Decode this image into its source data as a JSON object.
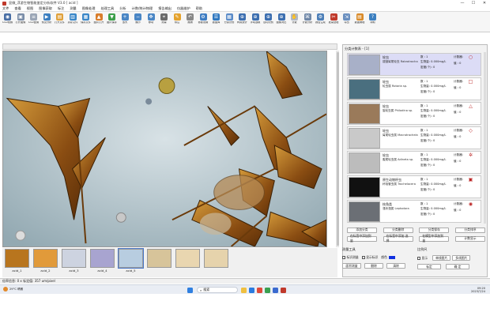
{
  "window": {
    "title": "显微_浮游生物智能鉴定分析软件 V3.0 [ acid ]",
    "controls": [
      "—",
      "☐",
      "✕"
    ]
  },
  "menu": [
    "文件",
    "查看",
    "视图",
    "图像获取",
    "标注",
    "测量",
    "图像处理",
    "处理工具",
    "分析",
    "计数/统计物理",
    "报告输出",
    "仪器维护",
    "帮助"
  ],
  "toolbar": [
    {
      "label": "CCD视频",
      "color": "#4a6fa5",
      "glyph": "◉"
    },
    {
      "label": "打开图像",
      "color": "#7a8da8",
      "glyph": "▣"
    },
    {
      "label": "CCD配置",
      "color": "#9aa5b5",
      "glyph": "≡"
    },
    {
      "label": "预览分析",
      "color": "#3c7fc0",
      "glyph": "▶"
    },
    {
      "label": "打开文件",
      "color": "#e0a13a",
      "glyph": "▤"
    },
    {
      "label": "另存文件",
      "color": "#3a87c8",
      "glyph": "▥"
    },
    {
      "label": "保存文件",
      "color": "#3a87c8",
      "glyph": "▦"
    },
    {
      "label": "图片打开",
      "color": "#d97d2b",
      "glyph": "▲"
    },
    {
      "label": "图片保存",
      "color": "#3c9f4a",
      "glyph": "▼"
    },
    {
      "label": "放大",
      "color": "#4a86c5",
      "glyph": "+"
    },
    {
      "label": "缩小",
      "color": "#4a86c5",
      "glyph": "−"
    },
    {
      "label": "移动",
      "color": "#4a86c5",
      "glyph": "✥"
    },
    {
      "label": "测量",
      "color": "#6b6b6b",
      "glyph": "⌖"
    },
    {
      "label": "标注",
      "color": "#e4a22c",
      "glyph": "✎"
    },
    {
      "label": "撤销",
      "color": "#888888",
      "glyph": "↶"
    },
    {
      "label": "参数设置",
      "color": "#3f7dc3",
      "glyph": "⚙"
    },
    {
      "label": "数据库",
      "color": "#2f78c0",
      "glyph": "☰"
    },
    {
      "label": "分类识别",
      "color": "#5a8bc8",
      "glyph": "▦"
    },
    {
      "label": "种类统计",
      "color": "#3d6fb0",
      "glyph": "⊕"
    },
    {
      "label": "手动选取",
      "color": "#3d6fb0",
      "glyph": "⊕"
    },
    {
      "label": "自动识别",
      "color": "#3d6fb0",
      "glyph": "⊕"
    },
    {
      "label": "图像对比",
      "color": "#3d6fb0",
      "glyph": "⊕"
    },
    {
      "label": "计数",
      "color": "#b0b8c4",
      "glyph": "✋"
    },
    {
      "label": "计数分析",
      "color": "#7088a8",
      "glyph": "⌘"
    },
    {
      "label": "报告生成",
      "color": "#4d7fb8",
      "glyph": "⚙"
    },
    {
      "label": "批量处理",
      "color": "#c0392b",
      "glyph": "✂"
    },
    {
      "label": "导出",
      "color": "#6a8fbf",
      "glyph": "⇲"
    },
    {
      "label": "数据管理",
      "color": "#d98b2a",
      "glyph": "▤"
    },
    {
      "label": "帮助",
      "color": "#3c7fc0",
      "glyph": "?"
    }
  ],
  "thumbnails": [
    {
      "caption": "acid_1",
      "color": "#b8751e"
    },
    {
      "caption": "acid_2",
      "color": "#e19a3a"
    },
    {
      "caption": "acid_3",
      "color": "#cdd3e0"
    },
    {
      "caption": "acid_4",
      "color": "#a8a4d0"
    },
    {
      "caption": "acid_5",
      "color": "#b8cde0",
      "selected": true
    },
    {
      "caption": "",
      "color": "#d7c49a"
    },
    {
      "caption": "",
      "color": "#e9d6b0"
    },
    {
      "caption": "",
      "color": "#e6d3ac"
    }
  ],
  "status": "倍率信息: 0 x    标定值: 357 um/pixel",
  "rightpanel": {
    "header": "分类计数表 - [1]",
    "planktons": [
      {
        "name": "轮虫",
        "latin": "褶皱臂尾轮虫 Rabrotrocha",
        "f1": "数 : 1",
        "f2": "生物量: 0.000mg/L",
        "f3": "密度(个): 0",
        "ce": "计数器:",
        "cv": "值 : 0",
        "marker": "○",
        "photo": "#a8b0c8",
        "selected": true
      },
      {
        "name": "轮虫",
        "latin": "轮虫属 Rotaria sp.",
        "f1": "数 : 1",
        "f2": "生物量: 0.000mg/L",
        "f3": "密度(个): 0",
        "ce": "计数器:",
        "cv": "值 : 0",
        "marker": "□",
        "photo": "#4a6f7f"
      },
      {
        "name": "轮虫",
        "latin": "旋轮虫属 Philodina sp.",
        "f1": "数 : 1",
        "f2": "生物量: 0.000mg/L",
        "f3": "密度(个): 0",
        "ce": "计数器:",
        "cv": "值 : 0",
        "marker": "△",
        "photo": "#9a7a5a"
      },
      {
        "name": "轮虫",
        "latin": "臂尾轮虫属 Macrotrachela",
        "f1": "数 : 1",
        "f2": "生物量: 0.000mg/L",
        "f3": "密度(个): 0",
        "ce": "计数器:",
        "cv": "值 : 0",
        "marker": "◇",
        "photo": "#c9c9c9"
      },
      {
        "name": "轮虫",
        "latin": "腹尾轮虫属 Adineta sp.",
        "f1": "数 : 1",
        "f2": "生物量: 0.000mg/L",
        "f3": "密度(个): 0",
        "ce": "计数器:",
        "cv": "值 : 0",
        "marker": "✲",
        "photo": "#bcbcbc"
      },
      {
        "name": "原生动物杯虫",
        "latin": "杯吸管虫属 Trochelocera",
        "f1": "数 : 1",
        "f2": "生物量: 0.000mg/L",
        "f3": "密度(个): 0",
        "ce": "计数器:",
        "cv": "值 : 0",
        "marker": "▣",
        "photo": "#111111"
      },
      {
        "name": "枝角类",
        "latin": "溞状溞属 Leptodora",
        "f1": "数 : 1",
        "f2": "生物量: 0.000mg/L",
        "f3": "密度(个): 0",
        "ce": "计数器:",
        "cv": "值 : 0",
        "marker": "◉",
        "photo": "#6b6f75"
      }
    ],
    "btnrow1": [
      "添加分类",
      "分类删除",
      "分类保存",
      "分类排序"
    ],
    "btnrow2": [
      "在标签中添加到量",
      "在标签中添加 选择",
      "在模型中添加到量",
      "计数显示"
    ],
    "sort_label": "计数显示",
    "sort_value": "3"
  },
  "measure": {
    "header": "测量工具",
    "chk1": "标识测量",
    "chk2": "显示标识",
    "chk3": "颜色",
    "buttons": [
      "面积测量",
      "删除",
      "清除"
    ]
  },
  "compare": {
    "header": "比例尺",
    "chk1": "显示",
    "chk2": "单线图片",
    "buttons": [
      "多线图片",
      "标定",
      "确 定"
    ]
  },
  "taskbar": {
    "weather": "29°C 晴朗",
    "search": "搜索",
    "time": "09:20",
    "date": "2023/7/24"
  }
}
